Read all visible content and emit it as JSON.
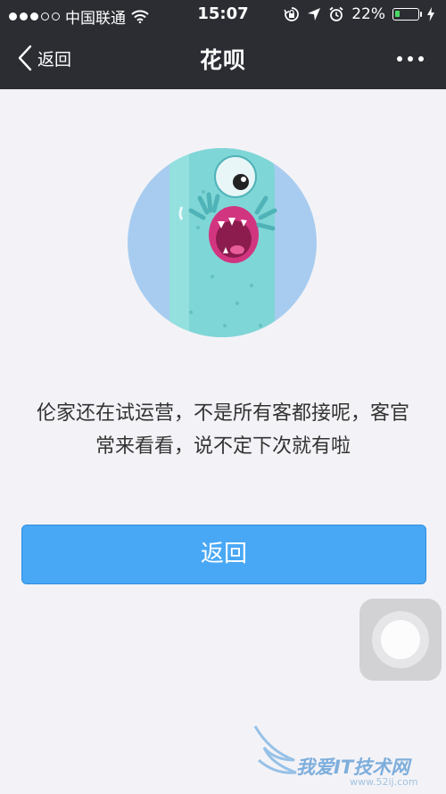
{
  "status_bar": {
    "carrier": "中国联通",
    "time": "15:07",
    "battery_percent": "22%",
    "battery_level": 0.22,
    "signal_bars_filled": 3,
    "signal_bars_total": 5
  },
  "nav": {
    "back_label": "返回",
    "title": "花呗"
  },
  "message": "伦家还在试运营，不是所有客都接呢，客官常来看看，说不定下次就有啦",
  "button": {
    "label": "返回"
  },
  "watermark": {
    "text": "我爱IT技术网",
    "url": "www.52ij.com"
  },
  "colors": {
    "nav_bg": "#2b2d33",
    "page_bg": "#f3f3f7",
    "button_blue": "#49a8f5",
    "battery_green": "#4cd964",
    "monster_teal": "#7fd6d6",
    "circle_blue": "#a8ccf0"
  },
  "icons": [
    "signal-dots-icon",
    "wifi-icon",
    "rotation-lock-icon",
    "location-arrow-icon",
    "alarm-icon",
    "battery-icon",
    "chevron-left-icon",
    "more-dots-icon",
    "assistive-touch-icon"
  ]
}
